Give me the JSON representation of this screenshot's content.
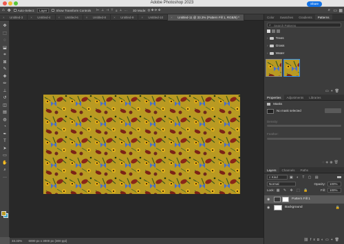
{
  "app": {
    "title": "Adobe Photoshop 2023"
  },
  "options_bar": {
    "auto_select_label": "Auto-Select:",
    "auto_select_value": "Layer",
    "transform_label": "Show Transform Controls",
    "mode_3d": "3D Mode:",
    "share_label": "Share"
  },
  "tabs": [
    {
      "label": "Untitled-3",
      "active": false
    },
    {
      "label": "Untitled-4",
      "active": false
    },
    {
      "label": "Untitled-6",
      "active": false
    },
    {
      "label": "Untitled-8",
      "active": false
    },
    {
      "label": "Untitled-9",
      "active": false
    },
    {
      "label": "Untitled-10",
      "active": false
    },
    {
      "label": "Untitled-11 @ 33.3% (Pattern Fill 1, RGB/8) *",
      "active": true
    }
  ],
  "tools": [
    "move-icon",
    "marquee-icon",
    "lasso-icon",
    "object-select-icon",
    "crop-icon",
    "frame-icon",
    "eyedropper-icon",
    "healing-icon",
    "brush-icon",
    "stamp-icon",
    "history-brush-icon",
    "eraser-icon",
    "gradient-icon",
    "blur-icon",
    "dodge-icon",
    "pen-icon",
    "type-icon",
    "path-select-icon",
    "shape-icon",
    "hand-icon",
    "zoom-icon",
    "more-icon"
  ],
  "status": {
    "zoom": "33.33%",
    "doc_size": "6000 px x 3000 px (300 ppi)"
  },
  "patterns_panel": {
    "tabs": [
      "Color",
      "Swatches",
      "Gradients",
      "Patterns"
    ],
    "active_tab": "Patterns",
    "search_placeholder": "Search Patterns",
    "folders": [
      "Trees",
      "Grass",
      "Water"
    ]
  },
  "properties_panel": {
    "tabs": [
      "Properties",
      "Adjustments",
      "Libraries"
    ],
    "active_tab": "Properties",
    "section": "Masks",
    "mask_label": "No mask selected",
    "density_label": "Density:",
    "feather_label": "Feather:"
  },
  "layers_panel": {
    "tabs": [
      "Layers",
      "Channels",
      "Paths"
    ],
    "active_tab": "Layers",
    "kind_label": "Kind",
    "blend_mode": "Normal",
    "opacity_label": "Opacity:",
    "opacity_value": "100%",
    "lock_label": "Lock:",
    "fill_label": "Fill:",
    "fill_value": "100%",
    "layers": [
      {
        "name": "Pattern Fill 1",
        "selected": true
      },
      {
        "name": "Background",
        "selected": false
      }
    ]
  },
  "colors": {
    "accent": "#1473e6",
    "pattern_bg": "#b99a22"
  }
}
